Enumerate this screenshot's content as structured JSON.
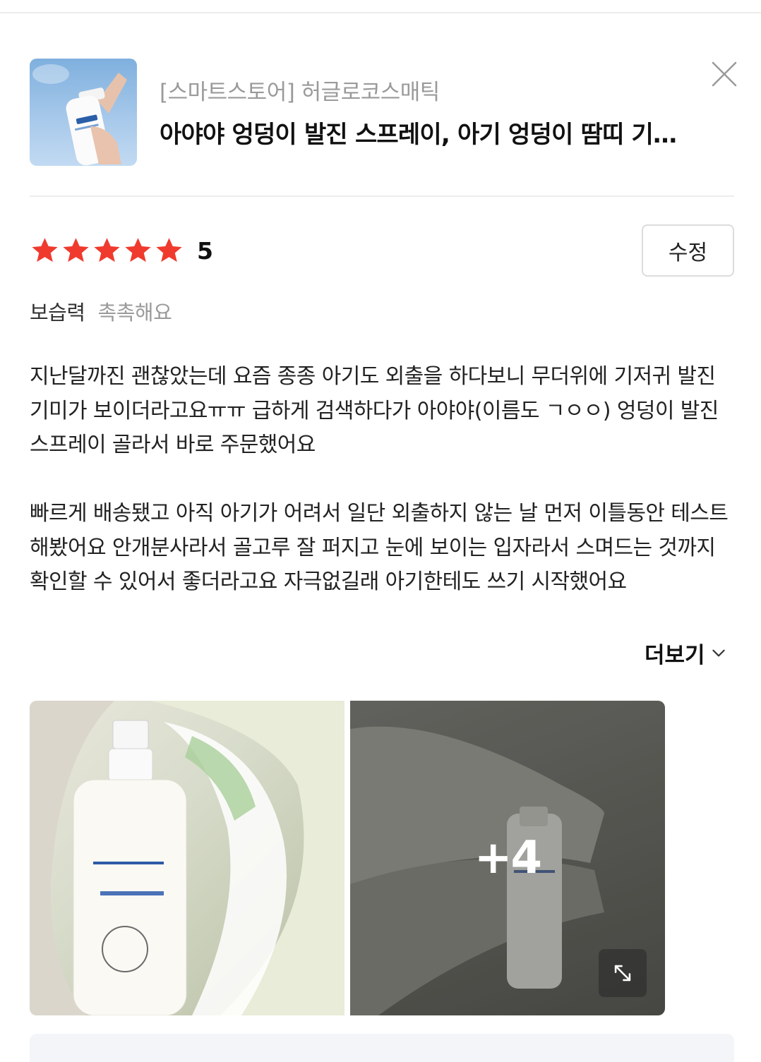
{
  "product": {
    "store": "[스마트스토어] 허글로코스매틱",
    "name": "아야야 엉덩이 발진 스프레이, 아기 엉덩이 땀띠 기저귀 발진",
    "thumbnail_icon": "product-thumbnail-spray-image",
    "close_icon": "close-icon"
  },
  "rating": {
    "stars": 5,
    "score": "5",
    "star_color": "#f03a2e"
  },
  "edit_button": "수정",
  "attribute": {
    "key": "보습력",
    "value": "촉촉해요"
  },
  "review": {
    "paragraph1": "지난달까진 괜찮았는데 요즘 종종 아기도 외출을 하다보니 무더위에 기저귀 발진 기미가 보이더라고요ㅠㅠ 급하게 검색하다가 아야야(이름도 ㄱㅇㅇ) 엉덩이 발진 스프레이 골라서 바로 주문했어요",
    "paragraph2": "빠르게 배송됐고 아직 아기가 어려서 일단 외출하지 않는 날 먼저 이틀동안 테스트해봤어요 안개분사라서 골고루 잘 퍼지고 눈에 보이는 입자라서 스며드는 것까지 확인할 수 있어서 좋더라고요 자극없길래 아기한테도 쓰기 시작했어요"
  },
  "more_button": "더보기",
  "photos": {
    "more_count": "+4",
    "expand_icon": "expand-icon"
  }
}
